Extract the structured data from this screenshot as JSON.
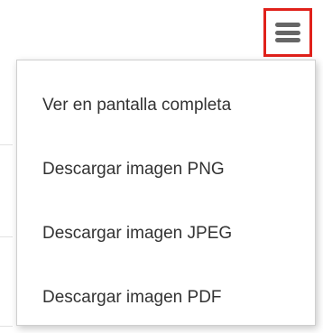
{
  "toolbar": {
    "menu_button_icon": "hamburger-icon",
    "highlight_color": "#e0211b"
  },
  "menu": {
    "items": [
      {
        "label": "Ver en pantalla completa"
      },
      {
        "label": "Descargar imagen PNG"
      },
      {
        "label": "Descargar imagen JPEG"
      },
      {
        "label": "Descargar imagen PDF"
      }
    ]
  }
}
